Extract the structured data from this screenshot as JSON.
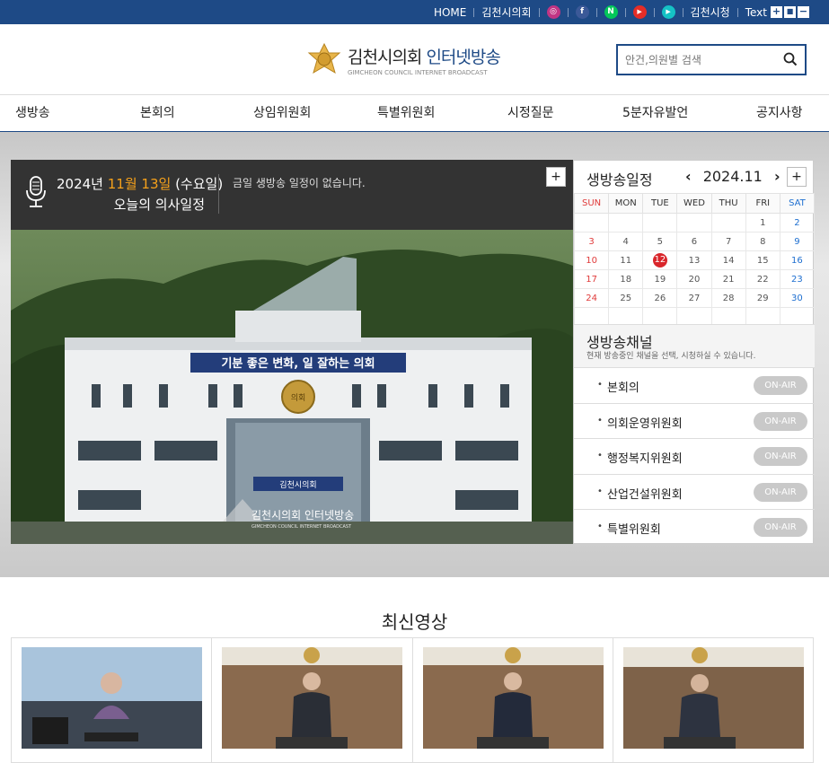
{
  "topbar": {
    "home": "HOME",
    "council": "김천시의회",
    "city_hall": "김천시청",
    "text_label": "Text",
    "social": [
      {
        "name": "instagram-icon",
        "color": "#c13584",
        "glyph": "◎"
      },
      {
        "name": "facebook-icon",
        "color": "#3b5998",
        "glyph": "f"
      },
      {
        "name": "naver-blog-icon",
        "color": "#03c75a",
        "glyph": "N"
      },
      {
        "name": "youtube-icon",
        "color": "#e52d27",
        "glyph": "▶"
      },
      {
        "name": "play-icon",
        "color": "#15c2c5",
        "glyph": "▶"
      }
    ],
    "zoom": [
      "+",
      "■",
      "−"
    ]
  },
  "header": {
    "logo_main": "김천시의회",
    "logo_accent": "인터넷방송",
    "logo_sub": "GIMCHEON COUNCIL INTERNET BROADCAST",
    "search_placeholder": "안건,의원별 검색"
  },
  "nav": [
    "생방송",
    "본회의",
    "상임위원회",
    "특별위원회",
    "시정질문",
    "5분자유발언",
    "공지사항"
  ],
  "schedule": {
    "date_prefix": "2024년 ",
    "date_month_day": "11월 13일",
    "date_suffix": " (수요일)",
    "subtitle": "오늘의 의사일정",
    "message": "금일 생방송 일정이 없습니다.",
    "more": "+"
  },
  "photo": {
    "banner": "기분 좋은 변화, 일 잘하는 의회",
    "sign": "김천시의회",
    "emblem": "의회",
    "watermark_main": "김천시의회 인터넷방송",
    "watermark_sub": "GIMCHEON COUNCIL INTERNET BROADCAST"
  },
  "calendar": {
    "title": "생방송일정",
    "month": "2024.11",
    "prev": "‹",
    "next": "›",
    "more": "+",
    "days": [
      "SUN",
      "MON",
      "TUE",
      "WED",
      "THU",
      "FRI",
      "SAT"
    ],
    "weeks": [
      [
        "",
        "",
        "",
        "",
        "",
        "1",
        "2"
      ],
      [
        "3",
        "4",
        "5",
        "6",
        "7",
        "8",
        "9"
      ],
      [
        "10",
        "11",
        "12",
        "13",
        "14",
        "15",
        "16"
      ],
      [
        "17",
        "18",
        "19",
        "20",
        "21",
        "22",
        "23"
      ],
      [
        "24",
        "25",
        "26",
        "27",
        "28",
        "29",
        "30"
      ],
      [
        "",
        "",
        "",
        "",
        "",
        "",
        ""
      ]
    ],
    "today": "12"
  },
  "channels": {
    "title": "생방송채널",
    "desc": "현재 방송중인 채널을 선택, 시청하실 수 있습니다.",
    "items": [
      {
        "name": "본회의",
        "status": "ON-AIR"
      },
      {
        "name": "의회운영위원회",
        "status": "ON-AIR"
      },
      {
        "name": "행정복지위원회",
        "status": "ON-AIR"
      },
      {
        "name": "산업건설위원회",
        "status": "ON-AIR"
      },
      {
        "name": "특별위원회",
        "status": "ON-AIR"
      }
    ]
  },
  "latest": {
    "title": "최신영상"
  }
}
